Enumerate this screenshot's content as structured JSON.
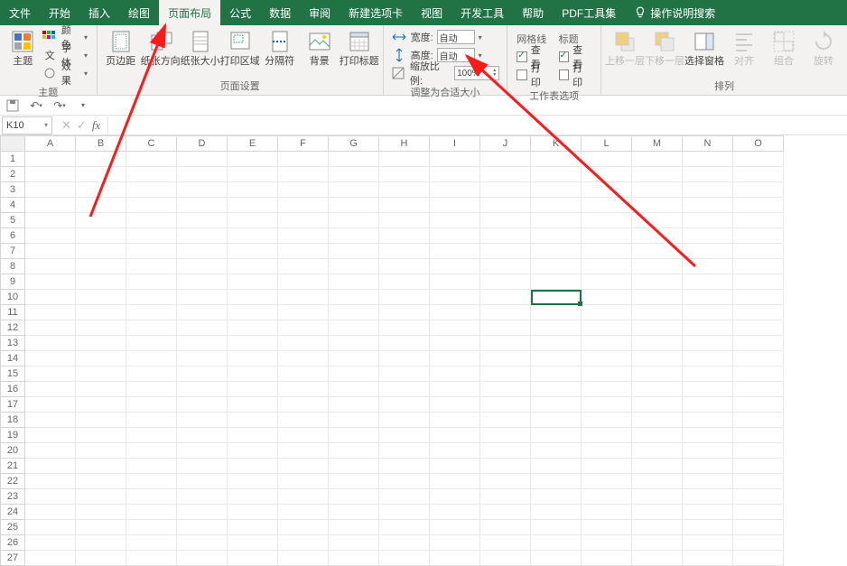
{
  "tabs": {
    "file": "文件",
    "home": "开始",
    "insert": "插入",
    "draw": "绘图",
    "page_layout": "页面布局",
    "formulas": "公式",
    "data": "数据",
    "review": "审阅",
    "new_tab": "新建选项卡",
    "view": "视图",
    "developer": "开发工具",
    "help": "帮助",
    "pdf": "PDF工具集",
    "tell_me": "操作说明搜索"
  },
  "ribbon": {
    "themes": {
      "themes": "主题",
      "colors": "颜色",
      "fonts": "字体",
      "effects": "效果",
      "group": "主题"
    },
    "page_setup": {
      "margins": "页边距",
      "orientation": "纸张方向",
      "size": "纸张大小",
      "print_area": "打印区域",
      "breaks": "分隔符",
      "background": "背景",
      "print_titles": "打印标题",
      "group": "页面设置"
    },
    "scale": {
      "width_label": "宽度:",
      "width_value": "自动",
      "height_label": "高度:",
      "height_value": "自动",
      "scale_label": "缩放比例:",
      "scale_value": "100%",
      "group": "调整为合适大小"
    },
    "sheet_options": {
      "gridlines_title": "网格线",
      "headings_title": "标题",
      "view": "查看",
      "print": "打印",
      "group": "工作表选项"
    },
    "arrange": {
      "bring_forward": "上移一层",
      "send_backward": "下移一层",
      "selection_pane": "选择窗格",
      "align": "对齐",
      "group_objects": "组合",
      "rotate": "旋转",
      "group": "排列"
    }
  },
  "namebox": "K10",
  "columns": [
    "A",
    "B",
    "C",
    "D",
    "E",
    "F",
    "G",
    "H",
    "I",
    "J",
    "K",
    "L",
    "M",
    "N",
    "O"
  ],
  "row_count": 27,
  "selected_cell": {
    "col_index": 10,
    "row_index": 9
  }
}
